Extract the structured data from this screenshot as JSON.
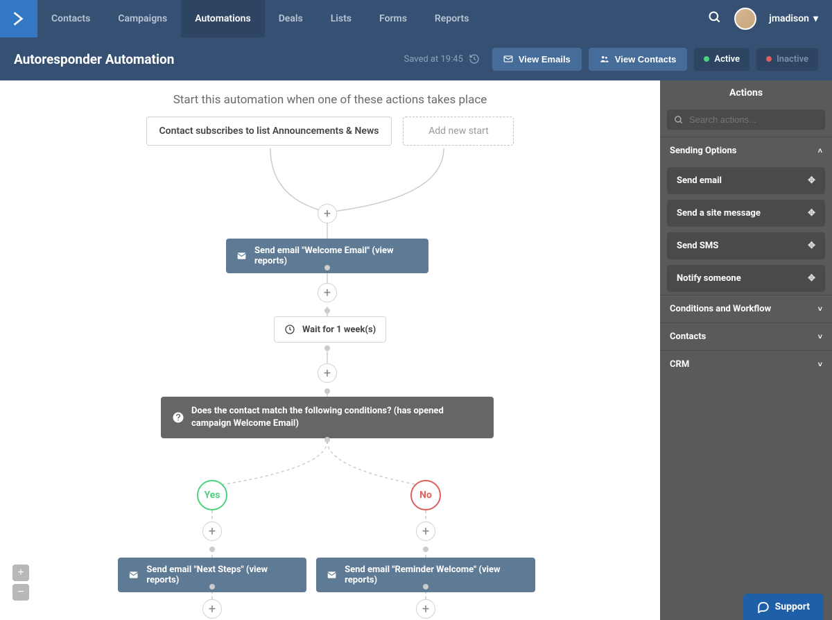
{
  "nav": {
    "items": [
      "Contacts",
      "Campaigns",
      "Automations",
      "Deals",
      "Lists",
      "Forms",
      "Reports"
    ],
    "active_index": 2,
    "username": "jmadison"
  },
  "subheader": {
    "title": "Autoresponder Automation",
    "saved_text": "Saved at 19:45",
    "view_emails": "View Emails",
    "view_contacts": "View Contacts",
    "active": "Active",
    "inactive": "Inactive"
  },
  "canvas": {
    "start_heading": "Start this automation when one of these actions takes place",
    "start_trigger": "Contact subscribes to list Announcements & News",
    "add_new_start": "Add new start",
    "node_email_1": "Send email \"Welcome Email\" (view reports)",
    "node_wait": "Wait for 1 week(s)",
    "node_condition": "Does the contact match the following conditions? (has opened campaign Welcome Email)",
    "yes": "Yes",
    "no": "No",
    "node_email_yes": "Send email \"Next Steps\" (view reports)",
    "node_email_no": "Send email \"Reminder Welcome\" (view reports)"
  },
  "sidebar": {
    "title": "Actions",
    "search_placeholder": "Search actions...",
    "sections": {
      "sending_options": "Sending Options",
      "conditions": "Conditions and Workflow",
      "contacts": "Contacts",
      "crm": "CRM"
    },
    "actions": [
      "Send email",
      "Send a site message",
      "Send SMS",
      "Notify someone"
    ]
  },
  "support": "Support"
}
